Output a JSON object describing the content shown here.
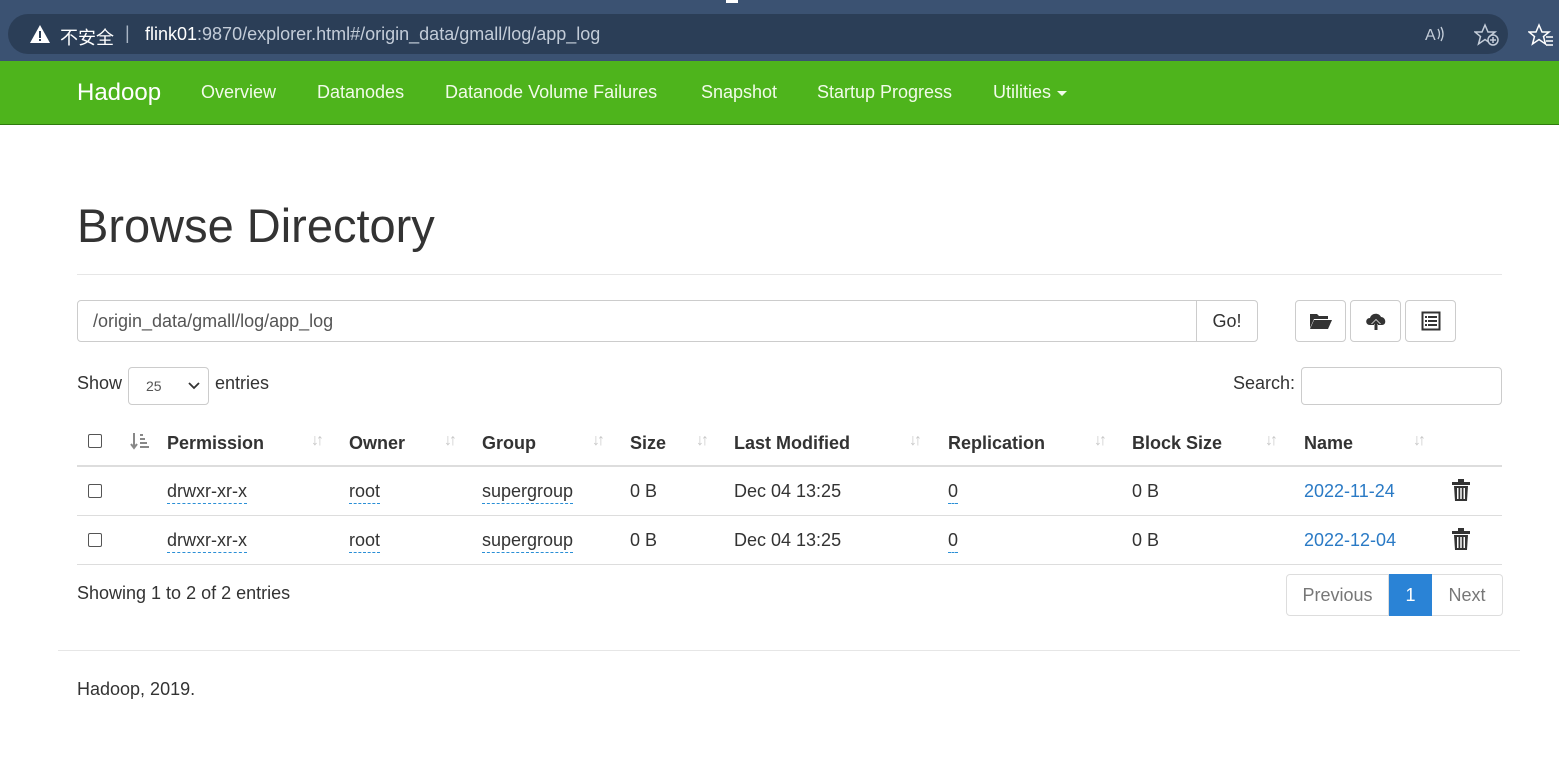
{
  "browser": {
    "insecure_label": "不安全",
    "separator": "|",
    "url_host": "flink01",
    "url_rest": ":9870/explorer.html#/origin_data/gmall/log/app_log",
    "read_aloud_label": "A̅"
  },
  "navbar": {
    "brand": "Hadoop",
    "items": [
      "Overview",
      "Datanodes",
      "Datanode Volume Failures",
      "Snapshot",
      "Startup Progress",
      "Utilities"
    ]
  },
  "page": {
    "title": "Browse Directory",
    "path_value": "/origin_data/gmall/log/app_log",
    "go_label": "Go!"
  },
  "controls": {
    "show_label": "Show",
    "entries_value": "25",
    "entries_label": "entries",
    "search_label": "Search:"
  },
  "table": {
    "columns": [
      "Permission",
      "Owner",
      "Group",
      "Size",
      "Last Modified",
      "Replication",
      "Block Size",
      "Name"
    ],
    "rows": [
      {
        "permission": "drwxr-xr-x",
        "owner": "root",
        "group": "supergroup",
        "size": "0 B",
        "modified": "Dec 04 13:25",
        "replication": "0",
        "block_size": "0 B",
        "name": "2022-11-24"
      },
      {
        "permission": "drwxr-xr-x",
        "owner": "root",
        "group": "supergroup",
        "size": "0 B",
        "modified": "Dec 04 13:25",
        "replication": "0",
        "block_size": "0 B",
        "name": "2022-12-04"
      }
    ],
    "info": "Showing 1 to 2 of 2 entries"
  },
  "pagination": {
    "previous": "Previous",
    "current": "1",
    "next": "Next"
  },
  "footer": {
    "text": "Hadoop, 2019."
  },
  "colors": {
    "navbar": "#4eb41c",
    "link": "#2a7ac5",
    "active_page": "#2a83d6"
  }
}
